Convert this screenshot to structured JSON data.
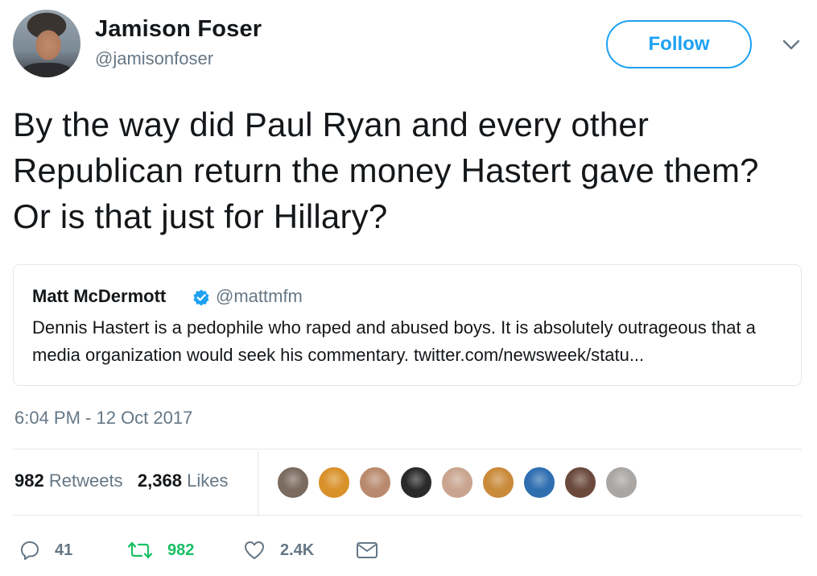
{
  "author": {
    "name": "Jamison Foser",
    "handle": "@jamisonfoser",
    "follow_label": "Follow"
  },
  "tweet": {
    "text": "By the way did Paul Ryan and every other Republican return the money Hastert gave them? Or is that just for Hillary?",
    "timestamp": "6:04 PM - 12 Oct 2017"
  },
  "quoted": {
    "name": "Matt McDermott",
    "verified": true,
    "handle": "@mattmfm",
    "text": "Dennis Hastert is a pedophile who raped and abused boys. It is absolutely outrageous that a media organization would seek his commentary. twitter.com/newsweek/statu..."
  },
  "stats": {
    "retweets_count": "982",
    "retweets_label": "Retweets",
    "likes_count": "2,368",
    "likes_label": "Likes"
  },
  "likers": [
    {
      "icon": "liker-avatar-1",
      "color": "#7b6a5e"
    },
    {
      "icon": "liker-avatar-2",
      "color": "#d9912a"
    },
    {
      "icon": "liker-avatar-3",
      "color": "#b98a6e"
    },
    {
      "icon": "liker-avatar-4",
      "color": "#2a2a2a"
    },
    {
      "icon": "liker-avatar-5",
      "color": "#c9a58f"
    },
    {
      "icon": "liker-avatar-6",
      "color": "#c98a3a"
    },
    {
      "icon": "liker-avatar-7",
      "color": "#2f6fb0"
    },
    {
      "icon": "liker-avatar-8",
      "color": "#6b4a3c"
    },
    {
      "icon": "liker-avatar-9",
      "color": "#a9a6a3"
    }
  ],
  "actions": {
    "reply_count": "41",
    "retweet_count": "982",
    "like_count": "2.4K"
  },
  "colors": {
    "accent": "#1da1f2",
    "retweet_green": "#17bf63",
    "muted": "#657786",
    "border": "#e1e8ed"
  }
}
